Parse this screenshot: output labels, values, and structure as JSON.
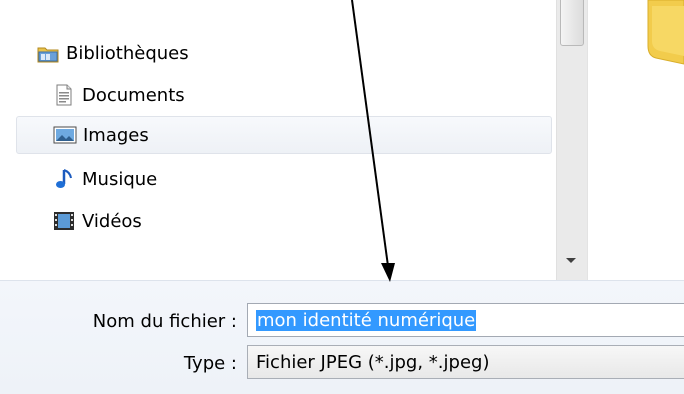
{
  "navigation": {
    "items": [
      {
        "label": "Bibliothèques",
        "icon": "libraries-icon"
      },
      {
        "label": "Documents",
        "icon": "documents-icon"
      },
      {
        "label": "Images",
        "icon": "images-icon"
      },
      {
        "label": "Musique",
        "icon": "music-icon"
      },
      {
        "label": "Vidéos",
        "icon": "videos-icon"
      }
    ],
    "selected": "Images"
  },
  "save_form": {
    "filename_label": "Nom du fichier :",
    "filename_value": "mon identité numérique",
    "type_label": "Type :",
    "type_value": "Fichier JPEG (*.jpg, *.jpeg)"
  },
  "colors": {
    "selection_highlight": "#3399ff",
    "selected_row_border": "#dfe3ea",
    "panel_background": "#eef2f8",
    "arrow": "#000000"
  }
}
